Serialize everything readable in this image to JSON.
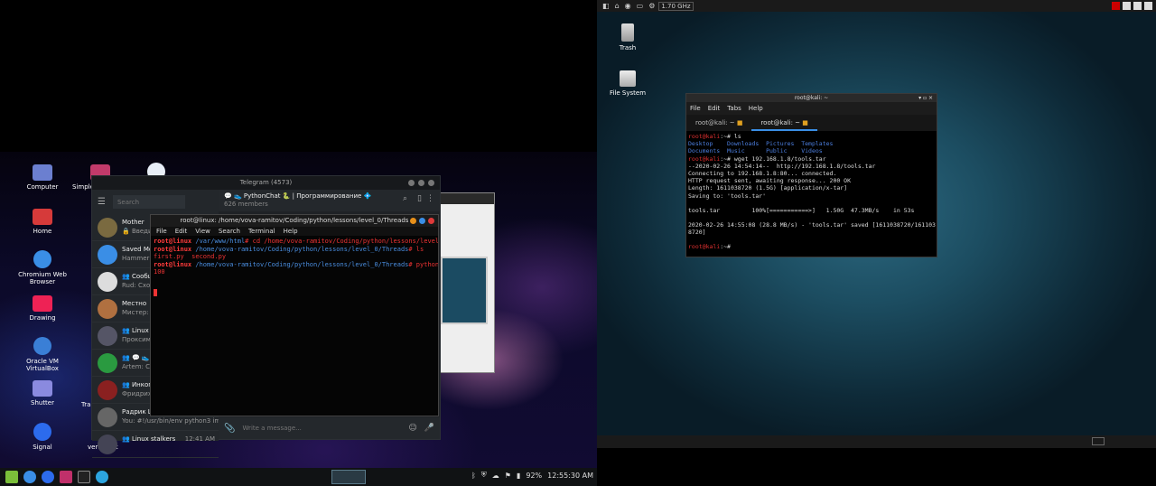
{
  "left_desktop": {
    "icons": [
      {
        "label": "Computer",
        "color": "#6b7fd0"
      },
      {
        "label": "Simple",
        "color": "#c23a6a"
      },
      {
        "label": "Home",
        "color": "#d63a3a"
      },
      {
        "label": "Chromium Web Browser",
        "color": "#3a8ee6"
      },
      {
        "label": "Drawing",
        "color": "#e25"
      },
      {
        "label": "Oracle VM VirtualBox",
        "color": "#3a7fd6"
      },
      {
        "label": "Shutter",
        "color": "#8a8adf"
      },
      {
        "label": "Tra",
        "color": "#555"
      },
      {
        "label": "Signal",
        "color": "#2c6bed"
      },
      {
        "label": "veracrypt",
        "color": "#444"
      }
    ],
    "telegram": {
      "title": "Telegram (4573)",
      "search_placeholder": "Search",
      "chat_title": "💬 👟 PythonChat 🐍 | Программирование 💠",
      "chat_members": "626 members",
      "input_placeholder": "Write a message...",
      "chats": [
        {
          "name": "Mother",
          "preview": "🔒 Введи",
          "color": "#7a6a40"
        },
        {
          "name": "Saved Mes",
          "preview": "Hammer: Ста",
          "color": "#3a8ee6"
        },
        {
          "name": "👥 Сообщ",
          "preview": "Rud: Схоле",
          "color": "#ddd"
        },
        {
          "name": "Местно",
          "preview": "Мистер: htt",
          "color": "#b07040"
        },
        {
          "name": "👥 Linux H",
          "preview": "Проксимо",
          "color": "#556"
        },
        {
          "name": "👥 💬 👟",
          "preview": "Artem: Скр",
          "color": "#2a9a40"
        },
        {
          "name": "👥 Инкогн",
          "preview": "Фридрих: ↩",
          "color": "#8a2020"
        },
        {
          "name": "Радрик Ш",
          "preview": "You: #!/usr/bin/env python3 im...",
          "color": "#666"
        },
        {
          "name": "👥 Linux stalkers",
          "preview": "",
          "time": "12:41 AM",
          "color": "#445"
        }
      ]
    },
    "terminal": {
      "title": "root@linux: /home/vova-ramitov/Coding/python/lessons/level_0/Threads",
      "menu": [
        "File",
        "Edit",
        "View",
        "Search",
        "Terminal",
        "Help"
      ],
      "lines": [
        {
          "prompt": "root@linux",
          "path": " /var/www/html",
          "cmd": "# cd /home/vova-ramitov/Coding/python/lessons/level_0/Threads/"
        },
        {
          "prompt": "root@linux",
          "path": " /home/vova-ramitov/Coding/python/lessons/level_0/Threads",
          "cmd": "# ls"
        },
        {
          "out": "first.py  second.py"
        },
        {
          "prompt": "root@linux",
          "path": " /home/vova-ramitov/Coding/python/lessons/level_0/Threads",
          "cmd": "# python3 second.py"
        },
        {
          "out": "100"
        }
      ]
    },
    "panel": {
      "clock": "12:55:30 AM",
      "battery": "92%"
    }
  },
  "right_desktop": {
    "top_bar": {
      "cpu": "1.70 GHz"
    },
    "icons": [
      {
        "label": "Trash"
      },
      {
        "label": "File System"
      }
    ],
    "terminal": {
      "title": "root@kali: ~",
      "menu": [
        "File",
        "Edit",
        "Tabs",
        "Help"
      ],
      "tabs": [
        "root@kali: ~",
        "root@kali: ~"
      ],
      "lines": [
        "root@kali:~# ls",
        "Desktop    Downloads  Pictures  Templates",
        "Documents  Music      Public    Videos",
        "root@kali:~# wget 192.168.1.8/tools.tar",
        "--2020-02-26 14:54:14--  http://192.168.1.8/tools.tar",
        "Connecting to 192.168.1.8:80... connected.",
        "HTTP request sent, awaiting response... 200 OK",
        "Length: 1611038720 (1.5G) [application/x-tar]",
        "Saving to: 'tools.tar'",
        "",
        "tools.tar         100%[===========>]   1.50G  47.3MB/s    in 53s",
        "",
        "2020-02-26 14:55:08 (28.8 MB/s) - 'tools.tar' saved [1611038720/161103",
        "8720]",
        "",
        "root@kali:~# "
      ]
    }
  }
}
